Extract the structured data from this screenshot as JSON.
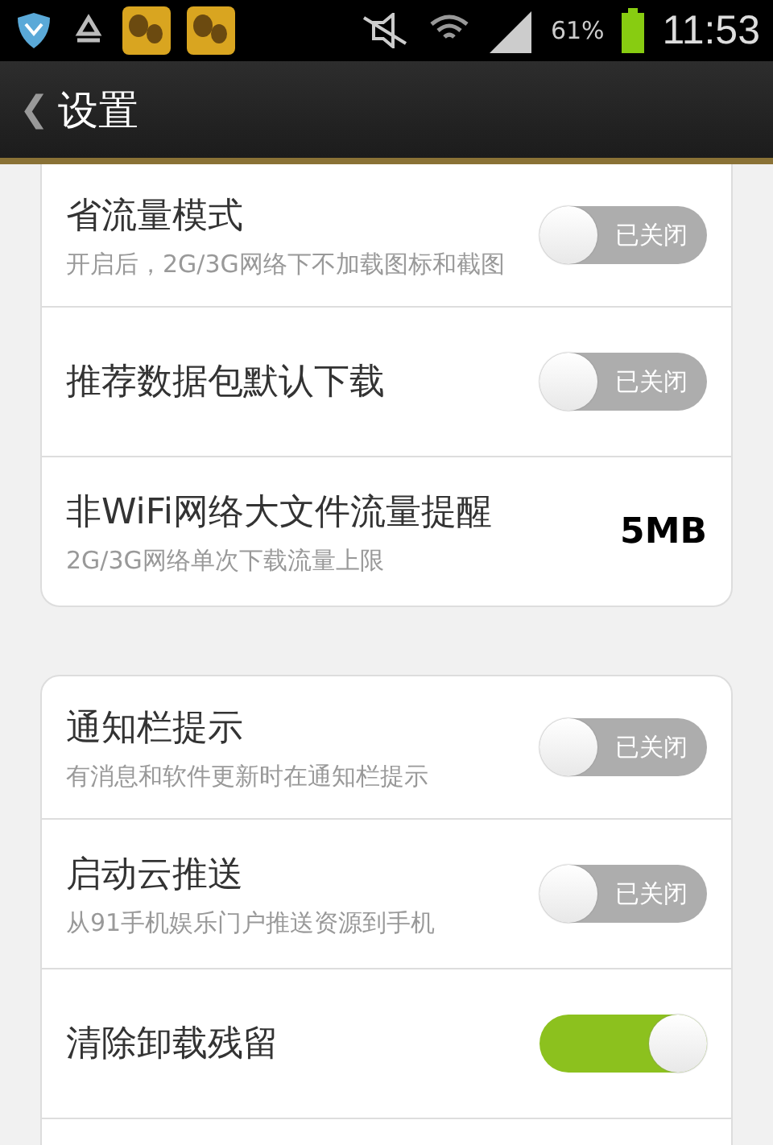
{
  "status_bar": {
    "battery_text": "61%",
    "time": "11:53"
  },
  "header": {
    "back": "❮",
    "title": "设置"
  },
  "groups": [
    {
      "items": [
        {
          "kind": "toggle",
          "title": "省流量模式",
          "subtitle": "开启后，2G/3G网络下不加载图标和截图",
          "on": false,
          "state_label": "已关闭"
        },
        {
          "kind": "toggle",
          "title": "推荐数据包默认下载",
          "on": false,
          "state_label": "已关闭"
        },
        {
          "kind": "value",
          "title": "非WiFi网络大文件流量提醒",
          "subtitle": "2G/3G网络单次下载流量上限",
          "value": "5MB"
        }
      ]
    },
    {
      "items": [
        {
          "kind": "toggle",
          "title": "通知栏提示",
          "subtitle": "有消息和软件更新时在通知栏提示",
          "on": false,
          "state_label": "已关闭"
        },
        {
          "kind": "toggle",
          "title": "启动云推送",
          "subtitle": "从91手机娱乐门户推送资源到手机",
          "on": false,
          "state_label": "已关闭"
        },
        {
          "kind": "toggle",
          "title": "清除卸载残留",
          "on": true
        }
      ]
    }
  ]
}
